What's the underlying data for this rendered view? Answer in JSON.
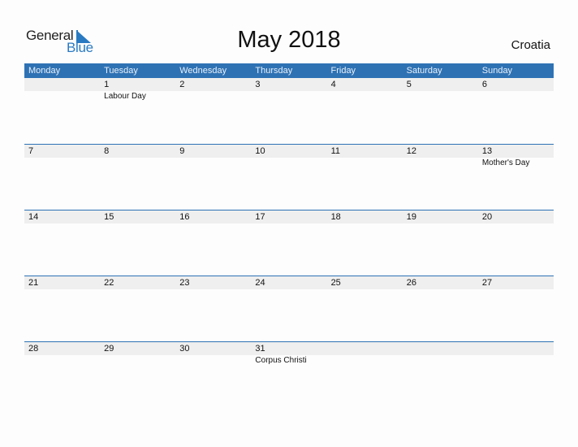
{
  "logo": {
    "line1": "General",
    "line2": "Blue",
    "accent_color": "#2a7ac2"
  },
  "title": "May 2018",
  "country": "Croatia",
  "header_color": "#2e72b4",
  "weekdays": [
    "Monday",
    "Tuesday",
    "Wednesday",
    "Thursday",
    "Friday",
    "Saturday",
    "Sunday"
  ],
  "weeks": [
    {
      "days": [
        {
          "num": "",
          "holiday": ""
        },
        {
          "num": "1",
          "holiday": "Labour Day"
        },
        {
          "num": "2",
          "holiday": ""
        },
        {
          "num": "3",
          "holiday": ""
        },
        {
          "num": "4",
          "holiday": ""
        },
        {
          "num": "5",
          "holiday": ""
        },
        {
          "num": "6",
          "holiday": ""
        }
      ]
    },
    {
      "days": [
        {
          "num": "7",
          "holiday": ""
        },
        {
          "num": "8",
          "holiday": ""
        },
        {
          "num": "9",
          "holiday": ""
        },
        {
          "num": "10",
          "holiday": ""
        },
        {
          "num": "11",
          "holiday": ""
        },
        {
          "num": "12",
          "holiday": ""
        },
        {
          "num": "13",
          "holiday": "Mother's Day"
        }
      ]
    },
    {
      "days": [
        {
          "num": "14",
          "holiday": ""
        },
        {
          "num": "15",
          "holiday": ""
        },
        {
          "num": "16",
          "holiday": ""
        },
        {
          "num": "17",
          "holiday": ""
        },
        {
          "num": "18",
          "holiday": ""
        },
        {
          "num": "19",
          "holiday": ""
        },
        {
          "num": "20",
          "holiday": ""
        }
      ]
    },
    {
      "days": [
        {
          "num": "21",
          "holiday": ""
        },
        {
          "num": "22",
          "holiday": ""
        },
        {
          "num": "23",
          "holiday": ""
        },
        {
          "num": "24",
          "holiday": ""
        },
        {
          "num": "25",
          "holiday": ""
        },
        {
          "num": "26",
          "holiday": ""
        },
        {
          "num": "27",
          "holiday": ""
        }
      ]
    },
    {
      "days": [
        {
          "num": "28",
          "holiday": ""
        },
        {
          "num": "29",
          "holiday": ""
        },
        {
          "num": "30",
          "holiday": ""
        },
        {
          "num": "31",
          "holiday": "Corpus Christi"
        },
        {
          "num": "",
          "holiday": ""
        },
        {
          "num": "",
          "holiday": ""
        },
        {
          "num": "",
          "holiday": ""
        }
      ]
    }
  ]
}
